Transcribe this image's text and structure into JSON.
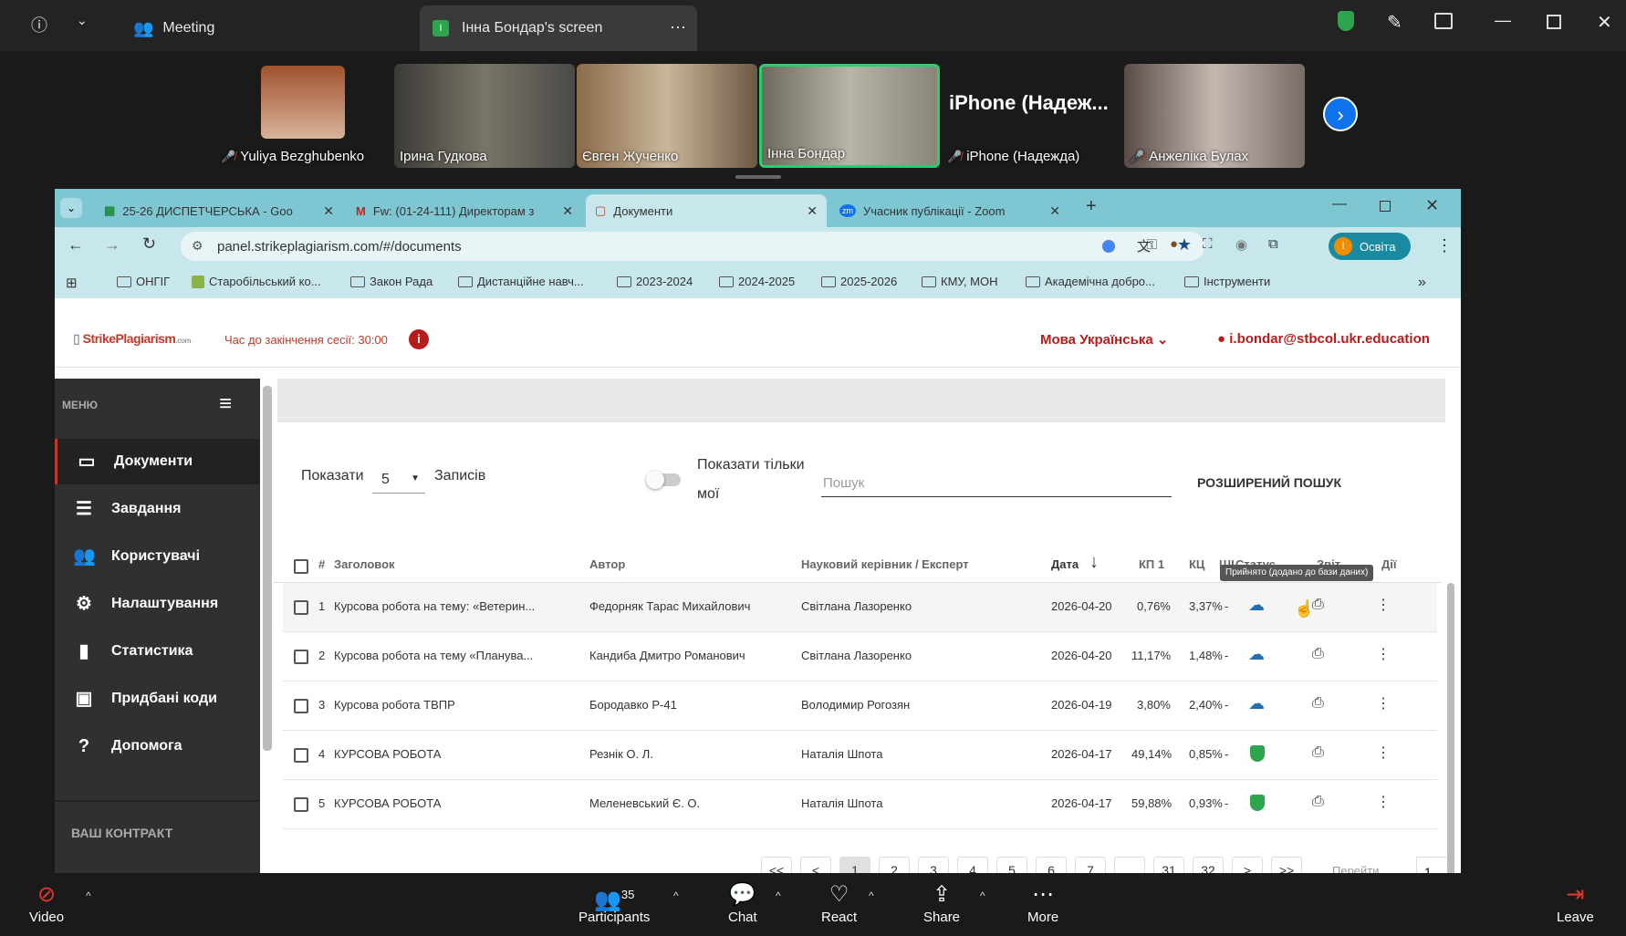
{
  "zoom": {
    "top": {
      "meeting_label": "Meeting",
      "share_title": "Інна Бондар's screen",
      "share_badge": "I"
    },
    "participants": [
      {
        "name": "Yuliya Bezghubenko"
      },
      {
        "name": "Ірина Гудкова"
      },
      {
        "name": "Євген Жученко"
      },
      {
        "name": "Інна Бондар"
      },
      {
        "name": "iPhone (Надежда)",
        "big_label": "iPhone  (Надеж..."
      },
      {
        "name": "Анжеліка Булах"
      }
    ],
    "bottom": {
      "video": "Video",
      "participants": "Participants",
      "participants_count": "35",
      "chat": "Chat",
      "react": "React",
      "share": "Share",
      "more": "More",
      "leave": "Leave"
    }
  },
  "browser": {
    "tabs": [
      {
        "title": "25-26 ДИСПЕТЧЕРСЬКА - Goo"
      },
      {
        "title": "Fw: (01-24-111) Директорам з"
      },
      {
        "title": "Документи"
      },
      {
        "title": "Учасник публікації - Zoom"
      }
    ],
    "url": "panel.strikeplagiarism.com/#/documents",
    "profile_label": "Освіта",
    "profile_initial": "I",
    "bookmarks": [
      "ОНГІГ",
      "Старобільський ко...",
      "Закон Рада",
      "Дистанційне навч...",
      "2023-2024",
      "2024-2025",
      "2025-2026",
      "КМУ, МОН",
      "Академічна добро...",
      "Інструменти"
    ]
  },
  "app": {
    "logo": "StrikePlagiarism",
    "logo_suffix": ".com",
    "session": "Час до закінчення сесії: 30:00",
    "language": "Мова Українська",
    "user_email": "i.bondar@stbcol.ukr.education",
    "menu_label": "МЕНЮ",
    "sidebar": [
      {
        "label": "Документи"
      },
      {
        "label": "Завдання"
      },
      {
        "label": "Користувачі"
      },
      {
        "label": "Налаштування"
      },
      {
        "label": "Статистика"
      },
      {
        "label": "Придбані коди"
      },
      {
        "label": "Допомога"
      }
    ],
    "contract_label": "ВАШ КОНТРАКТ",
    "show_label": "Показати",
    "show_value": "5",
    "records_label": "Записів",
    "only_mine_label_1": "Показати тільки",
    "only_mine_label_2": "мої",
    "search_placeholder": "Пошук",
    "advanced_search": "РОЗШИРЕНИЙ ПОШУК",
    "columns": {
      "num": "#",
      "title": "Заголовок",
      "author": "Автор",
      "supervisor": "Науковий керівник / Експерт",
      "date": "Дата",
      "kp1": "КП 1",
      "kc": "КЦ",
      "ai": "ШІ",
      "status": "Статус",
      "report": "Звіт",
      "actions": "Дії"
    },
    "tooltip": "Прийнято (додано до бази даних)",
    "rows": [
      {
        "num": "1",
        "title": "Курсова робота на тему: «Ветерин...",
        "author": "Федорняк Тарас Михайлович",
        "supervisor": "Світлана Лазоренко",
        "date": "2026-04-20",
        "kp1": "0,76%",
        "kc": "3,37%",
        "ai": "-",
        "status": "cloud"
      },
      {
        "num": "2",
        "title": "Курсова робота на тему «Планува...",
        "author": "Кандиба Дмитро Романович",
        "supervisor": "Світлана Лазоренко",
        "date": "2026-04-20",
        "kp1": "11,17%",
        "kc": "1,48%",
        "ai": "-",
        "status": "cloud"
      },
      {
        "num": "3",
        "title": "Курсова робота ТВПР",
        "author": "Бородавко Р-41",
        "supervisor": "Володимир Рогозян",
        "date": "2026-04-19",
        "kp1": "3,80%",
        "kc": "2,40%",
        "ai": "-",
        "status": "cloud"
      },
      {
        "num": "4",
        "title": "КУРСОВА РОБОТА",
        "author": "Резнік О. Л.",
        "supervisor": "Наталія Шпота",
        "date": "2026-04-17",
        "kp1": "49,14%",
        "kc": "0,85%",
        "ai": "-",
        "status": "shield"
      },
      {
        "num": "5",
        "title": "КУРСОВА РОБОТА",
        "author": "Меленевський Є. О.",
        "supervisor": "Наталія Шпота",
        "date": "2026-04-17",
        "kp1": "59,88%",
        "kc": "0,93%",
        "ai": "-",
        "status": "shield"
      }
    ],
    "pagination": [
      "<<",
      "<",
      "1",
      "2",
      "3",
      "4",
      "5",
      "6",
      "7",
      "...",
      "31",
      "32",
      ">",
      ">>"
    ],
    "goto_label": "Перейти",
    "goto_value": "1"
  }
}
